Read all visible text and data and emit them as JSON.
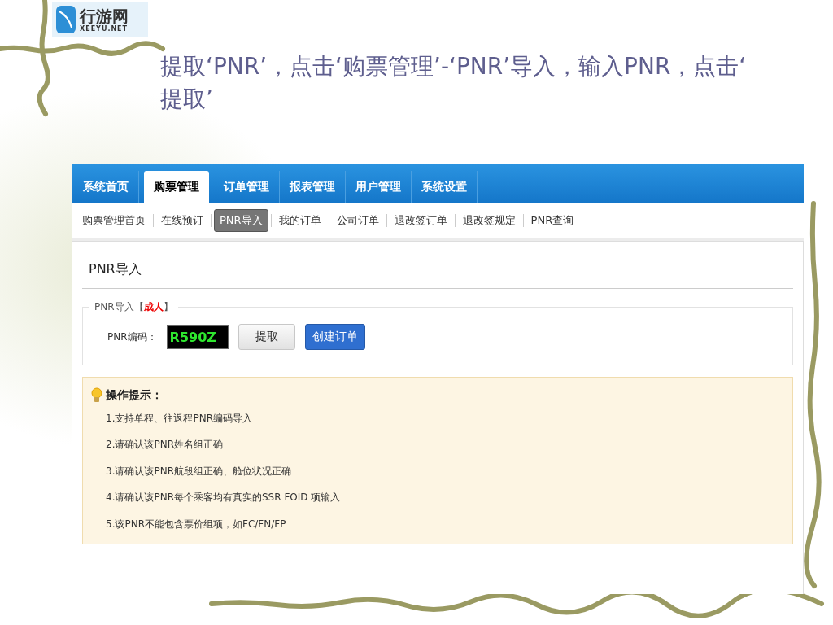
{
  "logo": {
    "name": "行游网",
    "domain": "XEEYU.NET"
  },
  "title": "提取‘PNR’，点击‘购票管理’-‘PNR’导入，输入PNR，点击‘提取’",
  "nav": [
    {
      "label": "系统首页",
      "selected": false
    },
    {
      "label": "购票管理",
      "selected": true
    },
    {
      "label": "订单管理",
      "selected": false
    },
    {
      "label": "报表管理",
      "selected": false
    },
    {
      "label": "用户管理",
      "selected": false
    },
    {
      "label": "系统设置",
      "selected": false
    }
  ],
  "subnav": [
    {
      "label": "购票管理首页",
      "selected": false
    },
    {
      "label": "在线预订",
      "selected": false
    },
    {
      "label": "PNR导入",
      "selected": true
    },
    {
      "label": "我的订单",
      "selected": false
    },
    {
      "label": "公司订单",
      "selected": false
    },
    {
      "label": "退改签订单",
      "selected": false
    },
    {
      "label": "退改签规定",
      "selected": false
    },
    {
      "label": "PNR查询",
      "selected": false
    }
  ],
  "page_title": "PNR导入",
  "legend": [
    {
      "text": "PNR导入【",
      "kind": "plain"
    },
    {
      "text": "成人",
      "kind": "highlight"
    },
    {
      "text": "】",
      "kind": "plain"
    }
  ],
  "pnr_field": {
    "label": "PNR编码：",
    "value": "R590Z"
  },
  "buttons": [
    {
      "label": "提取",
      "kind": "default"
    },
    {
      "label": "创建订单",
      "kind": "primary"
    }
  ],
  "tips": {
    "title": "操作提示：",
    "items": [
      "1.支持单程、往返程PNR编码导入",
      "2.请确认该PNR姓名组正确",
      "3.请确认该PNR航段组正确、舱位状况正确",
      "4.请确认该PNR每个乘客均有真实的SSR FOID 项输入",
      "5.该PNR不能包含票价组项，如FC/FN/FP"
    ]
  }
}
